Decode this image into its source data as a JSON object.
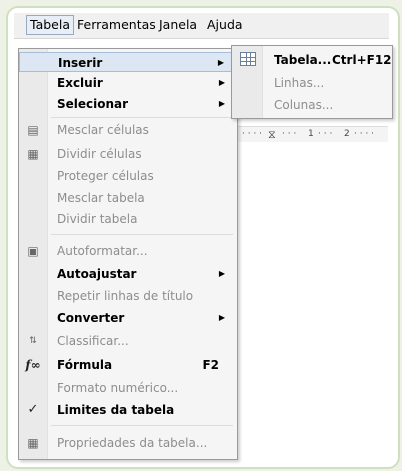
{
  "menubar": {
    "items": [
      {
        "label": "Tabela",
        "active": true
      },
      {
        "label": "Ferramentas"
      },
      {
        "label": "Janela"
      },
      {
        "label": "Ajuda"
      }
    ]
  },
  "ruler": {
    "marks": [
      "1",
      "2"
    ]
  },
  "menu": {
    "items": [
      {
        "label": "Inserir",
        "style": "bold",
        "submenu": true
      },
      {
        "label": "Excluir",
        "style": "bold",
        "submenu": true
      },
      {
        "label": "Selecionar",
        "style": "bold",
        "submenu": true
      },
      {
        "label": "Mesclar células",
        "style": "disabled",
        "icon": "merge-cells-icon"
      },
      {
        "label": "Dividir células",
        "style": "disabled",
        "icon": "split-cells-icon"
      },
      {
        "label": "Proteger células",
        "style": "disabled"
      },
      {
        "label": "Mesclar tabela",
        "style": "disabled"
      },
      {
        "label": "Dividir tabela",
        "style": "disabled"
      },
      {
        "label": "Autoformatar...",
        "style": "disabled",
        "icon": "autoformat-icon"
      },
      {
        "label": "Autoajustar",
        "style": "bold",
        "submenu": true
      },
      {
        "label": "Repetir linhas de título",
        "style": "disabled"
      },
      {
        "label": "Converter",
        "style": "bold",
        "submenu": true
      },
      {
        "label": "Classificar...",
        "style": "disabled",
        "icon": "sort-icon"
      },
      {
        "label": "Fórmula",
        "style": "bold",
        "shortcut": "F2",
        "icon": "formula-icon"
      },
      {
        "label": "Formato numérico...",
        "style": "disabled"
      },
      {
        "label": "Limites da tabela",
        "style": "bold",
        "checked": true
      },
      {
        "label": "Propriedades da tabela...",
        "style": "disabled",
        "icon": "table-properties-icon"
      }
    ]
  },
  "submenu": {
    "items": [
      {
        "label": "Tabela...",
        "shortcut": "Ctrl+F12",
        "style": "bold",
        "icon": "table-icon"
      },
      {
        "label": "Linhas...",
        "style": "disabled"
      },
      {
        "label": "Colunas...",
        "style": "disabled"
      }
    ]
  }
}
